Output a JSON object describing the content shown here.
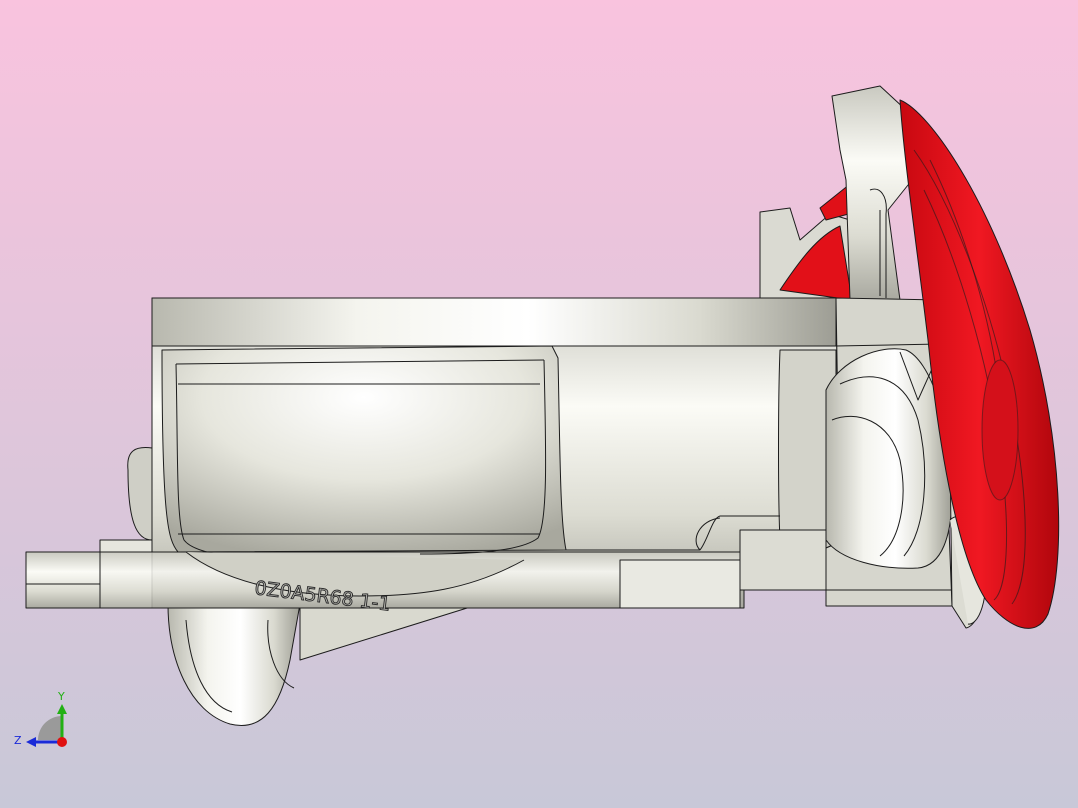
{
  "viewport": {
    "background_top": "#f9c3de",
    "background_bottom": "#c8c8d8",
    "part_color": "#e4e4dc",
    "face_highlight_color": "#e0141c",
    "edge_color": "#1c1c1c"
  },
  "part": {
    "engraving": "0Z0A5R68 1-1"
  },
  "triad": {
    "y_label": "Y",
    "z_label": "Z",
    "y_color": "#22b014",
    "z_color": "#1a2ad8",
    "x_color": "#e01010"
  }
}
